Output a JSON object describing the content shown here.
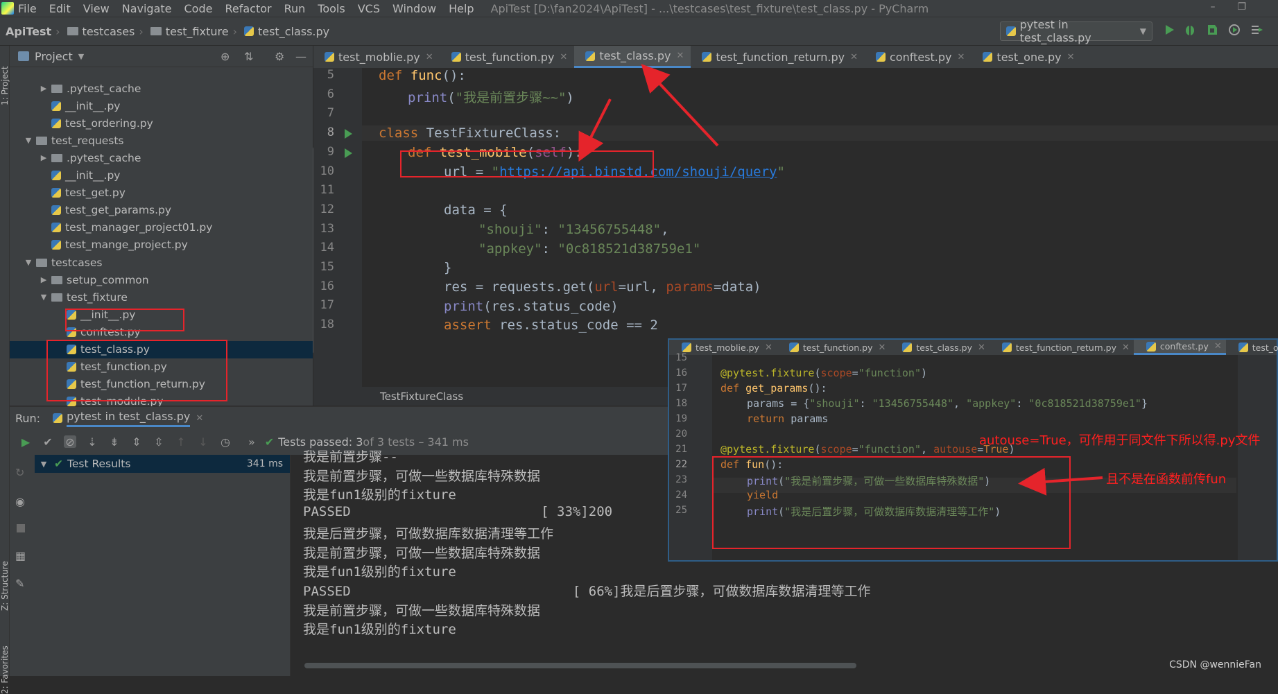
{
  "menu": {
    "items": [
      "File",
      "Edit",
      "View",
      "Navigate",
      "Code",
      "Refactor",
      "Run",
      "Tools",
      "VCS",
      "Window",
      "Help"
    ],
    "window_title": "ApiTest [D:\\fan2024\\ApiTest] - ...\\testcases\\test_fixture\\test_class.py - PyCharm"
  },
  "breadcrumb": {
    "items": [
      "ApiTest",
      "testcases",
      "test_fixture",
      "test_class.py"
    ]
  },
  "run_config": {
    "label": "pytest in test_class.py"
  },
  "project_panel": {
    "title": "Project",
    "tree": [
      {
        "label": ".pytest_cache",
        "type": "folder",
        "depth": 2,
        "expanded": false
      },
      {
        "label": "__init__.py",
        "type": "py",
        "depth": 2
      },
      {
        "label": "test_ordering.py",
        "type": "py",
        "depth": 2
      },
      {
        "label": "test_requests",
        "type": "folder",
        "depth": 1,
        "expanded": true
      },
      {
        "label": ".pytest_cache",
        "type": "folder",
        "depth": 2,
        "expanded": false
      },
      {
        "label": "__init__.py",
        "type": "py",
        "depth": 2
      },
      {
        "label": "test_get.py",
        "type": "py",
        "depth": 2
      },
      {
        "label": "test_get_params.py",
        "type": "py",
        "depth": 2
      },
      {
        "label": "test_manager_project01.py",
        "type": "py",
        "depth": 2
      },
      {
        "label": "test_mange_project.py",
        "type": "py",
        "depth": 2
      },
      {
        "label": "testcases",
        "type": "folder",
        "depth": 1,
        "expanded": true
      },
      {
        "label": "setup_common",
        "type": "folder",
        "depth": 2,
        "expanded": false
      },
      {
        "label": "test_fixture",
        "type": "folder",
        "depth": 2,
        "expanded": true
      },
      {
        "label": "__init__.py",
        "type": "py",
        "depth": 3
      },
      {
        "label": "conftest.py",
        "type": "py",
        "depth": 3
      },
      {
        "label": "test_class.py",
        "type": "py",
        "depth": 3,
        "selected": true
      },
      {
        "label": "test_function.py",
        "type": "py",
        "depth": 3
      },
      {
        "label": "test_function_return.py",
        "type": "py",
        "depth": 3
      },
      {
        "label": "test_module.py",
        "type": "py",
        "depth": 3
      }
    ]
  },
  "editor": {
    "tabs": [
      {
        "label": "test_moblie.py",
        "active": false
      },
      {
        "label": "test_function.py",
        "active": false
      },
      {
        "label": "test_class.py",
        "active": true
      },
      {
        "label": "test_function_return.py",
        "active": false
      },
      {
        "label": "conftest.py",
        "active": false
      },
      {
        "label": "test_one.py",
        "active": false
      }
    ],
    "line_numbers": [
      "5",
      "6",
      "7",
      "8",
      "9",
      "10",
      "11",
      "12",
      "13",
      "14",
      "15",
      "16",
      "17",
      "18"
    ],
    "code": {
      "l5": {
        "kw": "def ",
        "fn": "func",
        "rest": "():"
      },
      "l6": {
        "bi": "print",
        "p1": "(",
        "st": "\"我是前置步骤~~\"",
        "p2": ")"
      },
      "l8": {
        "kw": "class ",
        "name": "TestFixtureClass:"
      },
      "l9": {
        "kw": "def ",
        "fn": "test_mobile",
        "p1": "(",
        "sf": "self",
        "p2": "):"
      },
      "l10": {
        "a": "url = ",
        "q1": "\"",
        "url": "https://api.binstd.com/shouji/query",
        "q2": "\""
      },
      "l12": {
        "a": "data = {"
      },
      "l13": {
        "k": "\"shouji\"",
        "sep": ": ",
        "v": "\"13456755448\"",
        "end": ","
      },
      "l14": {
        "k": "\"appkey\"",
        "sep": ": ",
        "v": "\"0c818521d38759e1\""
      },
      "l15": {
        "a": "}"
      },
      "l16": {
        "a": "res = requests.get(",
        "p1": "url",
        "b": "=url, ",
        "p2": "params",
        "c": "=data)"
      },
      "l17": {
        "bi": "print",
        "a": "(res.status_code)"
      },
      "l18": {
        "kw": "assert ",
        "a": "res.status_code == 2"
      }
    },
    "breadcrumb": "TestFixtureClass"
  },
  "run_panel": {
    "label": "Run:",
    "tab_label": "pytest in test_class.py",
    "status_bold": "Tests passed: 3",
    "status_rest": " of 3 tests – 341 ms",
    "tree_root": "Test Results",
    "tree_time": "341 ms",
    "output": [
      "我是前置步骤--",
      "我是前置步骤，可做一些数据库特殊数据",
      "我是fun1级别的fixture",
      "PASSED                        [ 33%]200",
      "我是后置步骤，可做数据库数据清理等工作",
      "我是前置步骤，可做一些数据库特殊数据",
      "我是fun1级别的fixture",
      "PASSED                            [ 66%]我是后置步骤，可做数据库数据清理等工作",
      "我是前置步骤，可做一些数据库特殊数据",
      "我是fun1级别的fixture"
    ]
  },
  "side_labels": {
    "project": "1: Project",
    "structure": "Z: Structure",
    "favorites": "2: Favorites"
  },
  "inset": {
    "tabs": [
      {
        "label": "test_moblie.py",
        "active": false
      },
      {
        "label": "test_function.py",
        "active": false
      },
      {
        "label": "test_class.py",
        "active": false
      },
      {
        "label": "test_function_return.py",
        "active": false
      },
      {
        "label": "conftest.py",
        "active": true
      },
      {
        "label": "test_one.py",
        "active": false
      }
    ],
    "line_numbers": [
      "15",
      "16",
      "17",
      "18",
      "19",
      "20",
      "21",
      "22",
      "23",
      "24",
      "25"
    ],
    "code": {
      "l16": {
        "dec": "@pytest.fixture",
        "p1": "(",
        "pn": "scope",
        "eq": "=",
        "st": "\"function\"",
        "p2": ")"
      },
      "l17": {
        "kw": "def ",
        "fn": "get_params",
        "rest": "():"
      },
      "l18": {
        "a": "params = {",
        "k1": "\"shouji\"",
        "s1": ": ",
        "v1": "\"13456755448\"",
        "c1": ", ",
        "k2": "\"appkey\"",
        "s2": ": ",
        "v2": "\"0c818521d38759e1\"",
        "e": "}"
      },
      "l19": {
        "kw": "return ",
        "a": "params"
      },
      "l21": {
        "dec": "@pytest.fixture",
        "p1": "(",
        "pn": "scope",
        "eq": "=",
        "st": "\"function\"",
        "c": ", ",
        "pn2": "autouse",
        "eq2": "=",
        "kwv": "True",
        "p2": ")"
      },
      "l22": {
        "kw": "def ",
        "fn": "fun",
        "rest": "():"
      },
      "l23": {
        "bi": "print",
        "p1": "(",
        "st": "\"我是前置步骤，可做一些数据库特殊数据\"",
        "p2": ")"
      },
      "l24": {
        "kw": "yield"
      },
      "l25": {
        "bi": "print",
        "p1": "(",
        "st": "\"我是后置步骤，可做数据库数据清理等工作\"",
        "p2": ")"
      }
    }
  },
  "annotations": {
    "note1": "autouse=True，可作用于同文件下所以得.py文件",
    "note2": "且不是在函数前传fun"
  },
  "watermark": "CSDN @wennieFan",
  "colors": {
    "annotation_red": "#e5242b",
    "accent_blue": "#4a88c7",
    "run_green": "#499c54"
  }
}
